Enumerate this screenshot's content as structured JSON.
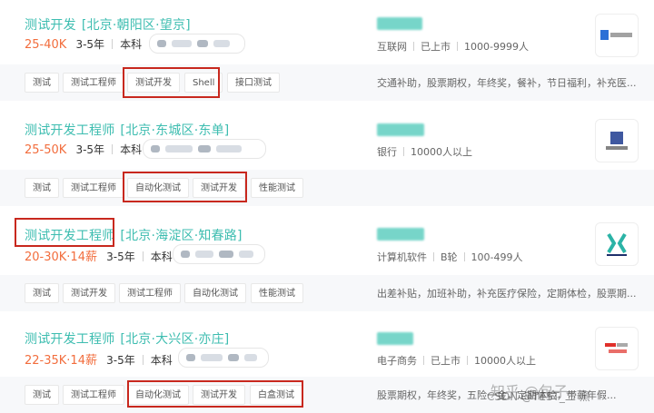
{
  "jobs": [
    {
      "title": "测试开发",
      "location": "[北京·朝阳区·望京]",
      "salary": "25-40K",
      "experience": "3-5年",
      "education": "本科",
      "company_type": "互联网",
      "company_stage": "已上市",
      "company_size": "1000-9999人",
      "tags": [
        "测试",
        "测试工程师",
        "测试开发",
        "Shell",
        "接口测试"
      ],
      "welfare": "交通补助，股票期权，年终奖，餐补，节日福利，补充医..."
    },
    {
      "title": "测试开发工程师",
      "location": "[北京·东城区·东单]",
      "salary": "25-50K",
      "experience": "3-5年",
      "education": "本科",
      "company_type": "银行",
      "company_size": "10000人以上",
      "tags": [
        "测试",
        "测试工程师",
        "自动化测试",
        "测试开发",
        "性能测试"
      ],
      "welfare": ""
    },
    {
      "title": "测试开发工程师",
      "location": "[北京·海淀区·知春路]",
      "salary": "20-30K·14薪",
      "experience": "3-5年",
      "education": "本科",
      "company_type": "计算机软件",
      "company_stage": "B轮",
      "company_size": "100-499人",
      "tags": [
        "测试",
        "测试开发",
        "测试工程师",
        "自动化测试",
        "性能测试"
      ],
      "welfare": "出差补贴，加班补助，补充医疗保险，定期体检，股票期..."
    },
    {
      "title": "测试开发工程师",
      "location": "[北京·大兴区·亦庄]",
      "salary": "22-35K·14薪",
      "experience": "3-5年",
      "education": "本科",
      "company_type": "电子商务",
      "company_stage": "已上市",
      "company_size": "10000人以上",
      "tags": [
        "测试",
        "测试工程师",
        "自动化测试",
        "测试开发",
        "白盒测试"
      ],
      "welfare": "股票期权，年终奖，五险一金，定期体检，带薪年假..."
    }
  ],
  "watermark": {
    "main": "知乎 @包子",
    "csdn": "CSDN @TEST_二 黑"
  },
  "colors": {
    "title": "#3dbdb0",
    "salary": "#f26d3d",
    "highlight": "#c8281e",
    "tag_bar": "#f7f8fa"
  }
}
